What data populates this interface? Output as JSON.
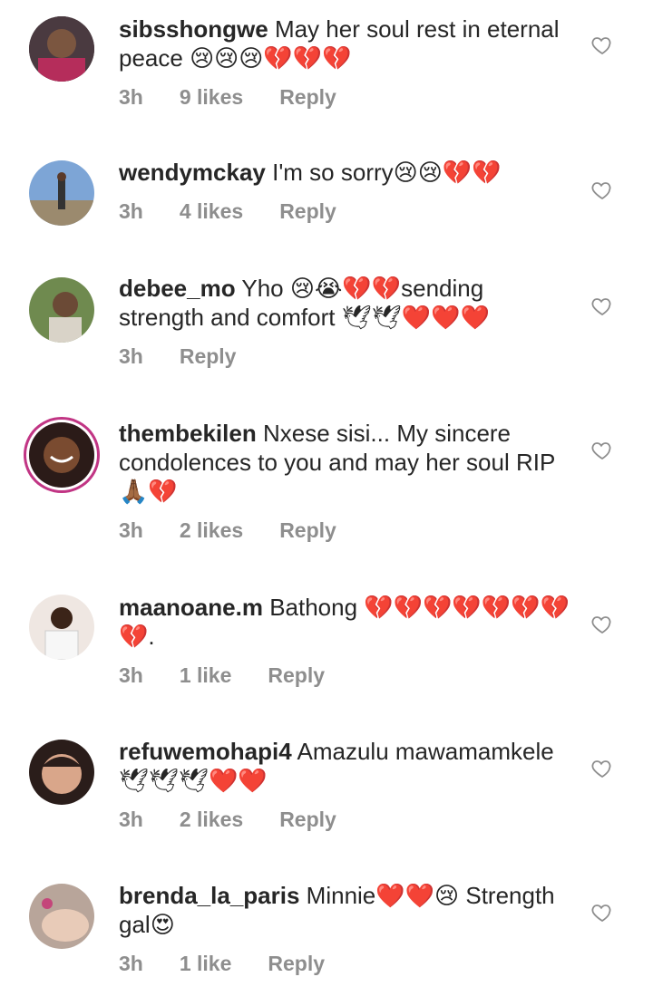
{
  "comments": [
    {
      "username": "sibsshongwe",
      "text": "May her soul rest in eternal peace",
      "emoji": "😢😢😢💔💔💔",
      "time": "3h",
      "likes": "9 likes",
      "reply": "Reply"
    },
    {
      "username": "wendymckay",
      "text": "I'm so sorry",
      "emoji": "😢😢💔💔",
      "time": "3h",
      "likes": "4 likes",
      "reply": "Reply"
    },
    {
      "username": "debee_mo",
      "text": "Yho",
      "emoji": "😢😭💔💔",
      "text2": "sending strength and comfort",
      "emoji2": "🕊🕊❤️❤️❤️",
      "time": "3h",
      "likes": "",
      "reply": "Reply"
    },
    {
      "username": "thembekilen",
      "text": "Nxese sisi... My sincere condolences to you and may her soul RIP",
      "emoji": "🙏🏾💔",
      "time": "3h",
      "likes": "2 likes",
      "reply": "Reply"
    },
    {
      "username": "maanoane.m",
      "text": "Bathong",
      "emoji": "💔💔💔💔💔💔💔💔.",
      "time": "3h",
      "likes": "1 like",
      "reply": "Reply"
    },
    {
      "username": "refuwemohapi4",
      "text": "Amazulu mawamamkele",
      "emoji": "🕊🕊🕊❤️❤️",
      "time": "3h",
      "likes": "2 likes",
      "reply": "Reply"
    },
    {
      "username": "brenda_la_paris",
      "text": "Minnie",
      "emoji": "❤️❤️😢",
      "text2": "Strength gal",
      "emoji2": "😍",
      "time": "3h",
      "likes": "1 like",
      "reply": "Reply"
    }
  ],
  "icons": {
    "like": "heart-outline-icon"
  },
  "colors": {
    "meta": "#8e8e8e",
    "story_ring": "#c13584"
  }
}
